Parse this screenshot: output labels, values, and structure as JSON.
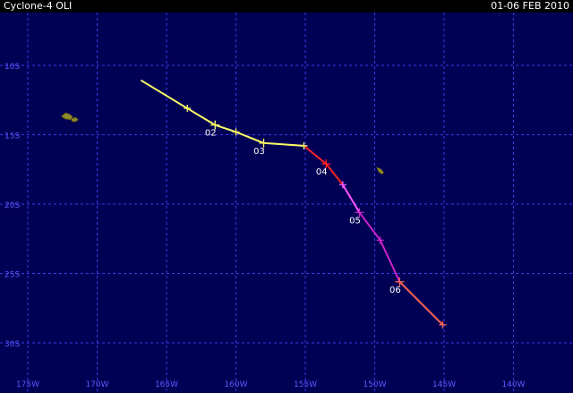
{
  "header": {
    "title": "Cyclone-4 OLI",
    "date_range": "01-06 FEB 2010"
  },
  "map": {
    "projection": "lon-lat grid",
    "lon_range": [
      -175,
      -135
    ],
    "lat_range": [
      -32.5,
      -5.5
    ],
    "lat_labels": [
      "10S",
      "15S",
      "20S",
      "25S",
      "30S"
    ],
    "lon_labels": [
      "175W",
      "170W",
      "165W",
      "160W",
      "155W",
      "150W",
      "145W",
      "140W"
    ],
    "colors": {
      "ocean": "#000055",
      "grid": "#3a3ae8",
      "axis_label": "#5a5aff",
      "land": "#8f8a2b"
    },
    "track": {
      "points": [
        {
          "lon": -166.8,
          "lat": -11.1,
          "stage": "depression"
        },
        {
          "lon": -163.5,
          "lat": -13.1,
          "stage": "depression"
        },
        {
          "lon": -161.5,
          "lat": -14.3,
          "stage": "depression",
          "label": "02"
        },
        {
          "lon": -160,
          "lat": -14.8,
          "stage": "depression"
        },
        {
          "lon": -158,
          "lat": -15.6,
          "stage": "depression",
          "label": "03"
        },
        {
          "lon": -155.1,
          "lat": -15.8,
          "stage": "depression"
        },
        {
          "lon": -153.5,
          "lat": -17.1,
          "stage": "tropical_storm",
          "label": "04"
        },
        {
          "lon": -152.3,
          "lat": -18.6,
          "stage": "cat1"
        },
        {
          "lon": -151.1,
          "lat": -20.6,
          "stage": "cat2",
          "label": "05"
        },
        {
          "lon": -149.6,
          "lat": -22.6,
          "stage": "cat2"
        },
        {
          "lon": -148.2,
          "lat": -25.6,
          "stage": "cat3",
          "label": "06"
        },
        {
          "lon": -145.1,
          "lat": -28.7,
          "stage": "cat3"
        }
      ],
      "stage_colors": {
        "depression": "#ffff66",
        "tropical_storm": "#ff2222",
        "cat1": "#ff55ff",
        "cat2": "#cc22cc",
        "cat3": "#ff6655"
      },
      "segment_stages": [
        "depression",
        "depression",
        "depression",
        "depression",
        "depression",
        "tropical_storm",
        "tropical_storm",
        "cat1",
        "cat2",
        "cat2",
        "cat3"
      ]
    },
    "islands": [
      {
        "name": "samoa-islands",
        "lon": -172,
        "lat": -13.8
      },
      {
        "name": "cook-islands",
        "lon": -149.6,
        "lat": -17.6
      }
    ]
  }
}
